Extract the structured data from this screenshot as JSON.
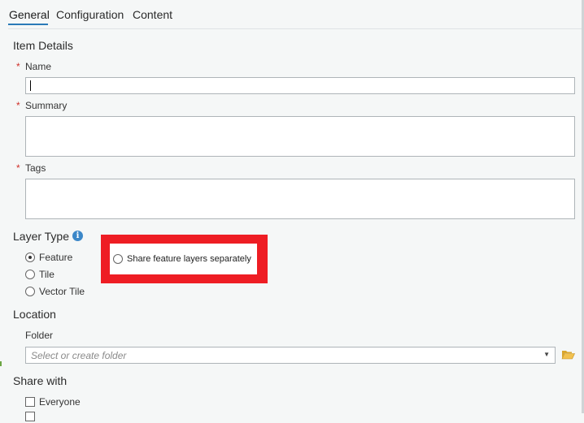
{
  "tabs": [
    {
      "label": "General",
      "active": true
    },
    {
      "label": "Configuration",
      "active": false
    },
    {
      "label": "Content",
      "active": false
    }
  ],
  "item_details": {
    "title": "Item Details",
    "required_marker": "*",
    "name_label": "Name",
    "name_value": "",
    "summary_label": "Summary",
    "summary_value": "",
    "tags_label": "Tags",
    "tags_value": ""
  },
  "layer_type": {
    "title": "Layer Type",
    "info_icon": "info-icon",
    "info_glyph": "i",
    "options": [
      "Feature",
      "Tile",
      "Vector Tile"
    ],
    "selected": "Feature",
    "share_separately_label": "Share feature layers separately",
    "share_separately_checked": false
  },
  "location": {
    "title": "Location",
    "folder_label": "Folder",
    "folder_placeholder": "Select or create folder",
    "folder_arrow": "▼",
    "browse_icon": "folder-open-icon"
  },
  "share_with": {
    "title": "Share with",
    "options": [
      {
        "label": "Everyone",
        "checked": false
      }
    ]
  },
  "colors": {
    "accent": "#2a7ab8",
    "required": "#d0302a",
    "highlight": "#ee1d24",
    "background": "#f5f7f7"
  }
}
